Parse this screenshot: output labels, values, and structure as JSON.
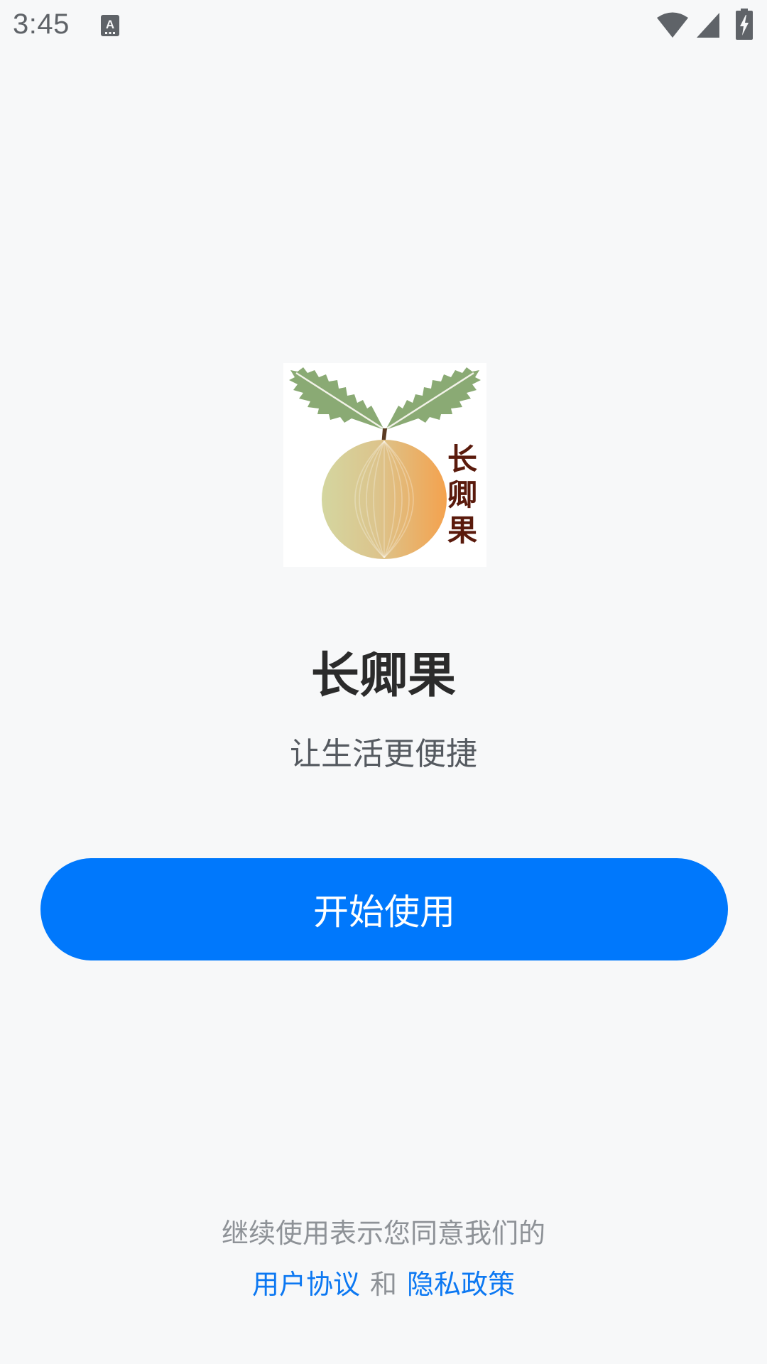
{
  "status_bar": {
    "time": "3:45",
    "icons": [
      "keyboard-a-icon",
      "wifi-icon",
      "signal-icon",
      "battery-charging-icon"
    ],
    "icon_color": "#5f6368"
  },
  "logo": {
    "text": "长卿果",
    "characters": [
      "长",
      "卿",
      "果"
    ],
    "text_color": "#5a1a0c",
    "leaf_color": "#8aaa74",
    "fruit_colors": [
      "#d4d6a0",
      "#f4a24e"
    ]
  },
  "app": {
    "name": "长卿果",
    "slogan": "让生活更便捷"
  },
  "start_button": {
    "label": "开始使用",
    "color": "#0078fc"
  },
  "consent": {
    "text": "继续使用表示您同意我们的",
    "user_agreement": "用户协议",
    "and": "和",
    "privacy_policy": "隐私政策",
    "link_color": "#0c78f2"
  }
}
